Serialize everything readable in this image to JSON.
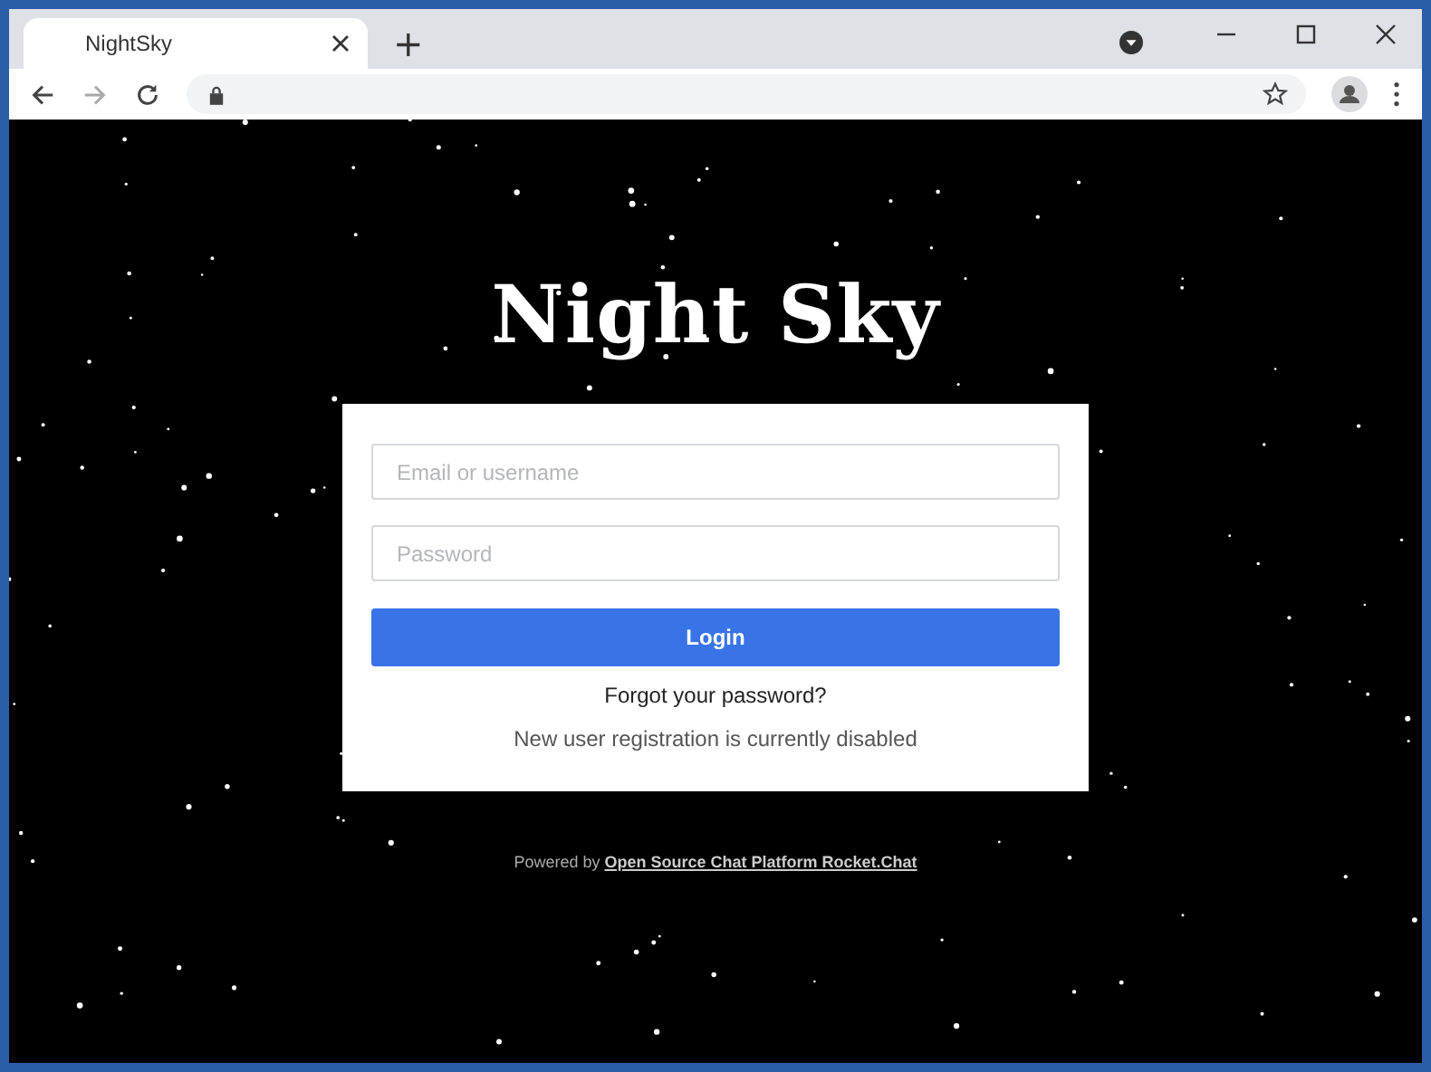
{
  "browser": {
    "tab_title": "NightSky",
    "new_tab": "+"
  },
  "page": {
    "logo": "Night Sky",
    "form": {
      "email": {
        "placeholder": "Email or username"
      },
      "password": {
        "placeholder": "Password"
      },
      "login_button": "Login",
      "forgot_link": "Forgot your password?",
      "registration_note": "New user registration is currently disabled"
    },
    "footer": {
      "prefix": "Powered by",
      "link": "Open Source Chat Platform Rocket.Chat"
    }
  }
}
